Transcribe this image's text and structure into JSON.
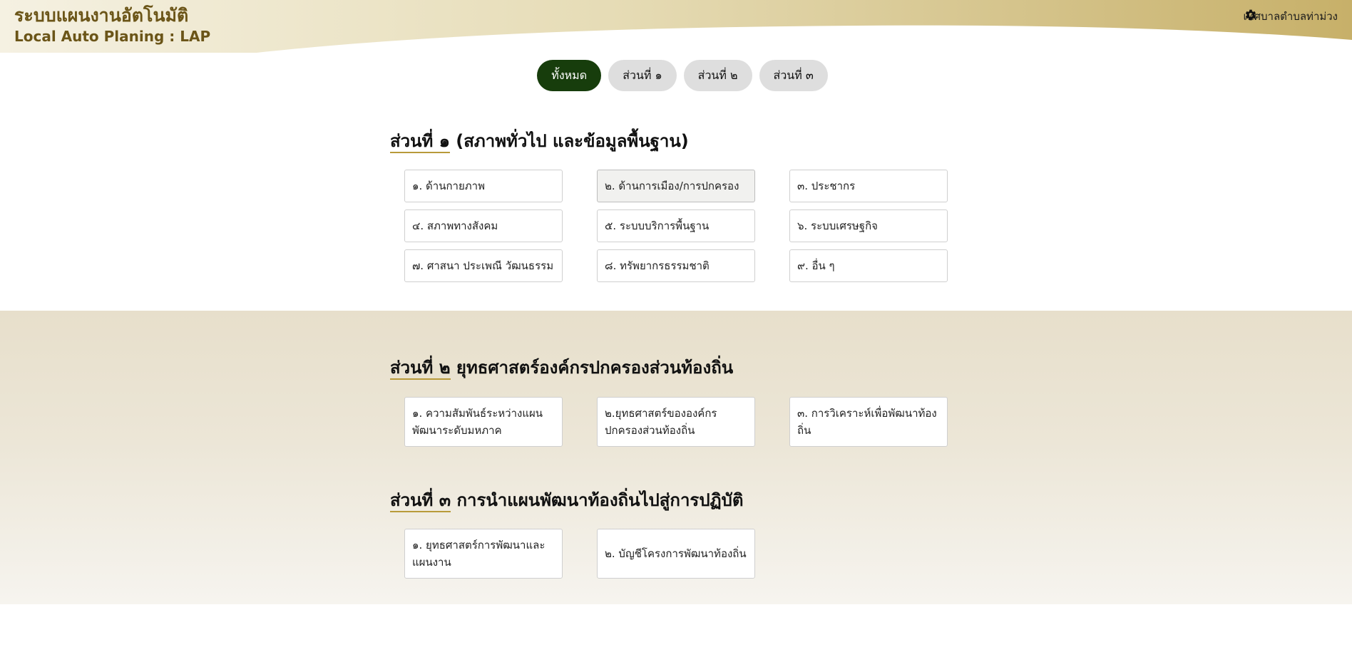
{
  "header": {
    "title": "ระบบแผนงานอัตโนมัติ",
    "subtitle": "Local Auto Planing : LAP",
    "org_name": "เทศบาลตำบลท่าม่วง",
    "settings_icon": "gear-icon"
  },
  "tabs": [
    {
      "label": "ทั้งหมด",
      "active": true
    },
    {
      "label": "ส่วนที่ ๑",
      "active": false
    },
    {
      "label": "ส่วนที่ ๒",
      "active": false
    },
    {
      "label": "ส่วนที่ ๓",
      "active": false
    }
  ],
  "section1": {
    "title_prefix": "ส่วนที่ ๑",
    "title_rest": " (สภาพทั่วไป และข้อมูลพื้นฐาน)",
    "items": [
      "๑. ด้านกายภาพ",
      "๒. ด้านการเมือง/การปกครอง",
      "๓. ประชากร",
      "๔. สภาพทางสังคม",
      "๕. ระบบบริการพื้นฐาน",
      "๖. ระบบเศรษฐกิจ",
      "๗. ศาสนา ประเพณี วัฒนธรรม",
      "๘. ทรัพยากรธรรมชาติ",
      "๙. อื่น ๆ"
    ]
  },
  "section2": {
    "title_prefix": "ส่วนที่ ๒",
    "title_rest": " ยุทธศาสตร์องค์กรปกครองส่วนท้องถิ่น",
    "items": [
      "๑. ความสัมพันธ์ระหว่างแผนพัฒนาระดับมหภาค",
      "๒.ยุทธศาสตร์ขององค์กรปกครองส่วนท้องถิ่น",
      "๓. การวิเคราะห์เพื่อพัฒนาท้องถิ่น"
    ]
  },
  "section3": {
    "title_prefix": "ส่วนที่ ๓",
    "title_rest": " การนำแผนพัฒนาท้องถิ่นไปสู่การปฏิบัติ",
    "items": [
      "๑. ยุทธศาสตร์การพัฒนาและแผนงาน",
      "๒. บัญชีโครงการพัฒนาท้องถิ่น"
    ]
  },
  "colors": {
    "brand": "#6b5518",
    "active_tab": "#173d0c",
    "gold_accent": "#b89a3a"
  }
}
